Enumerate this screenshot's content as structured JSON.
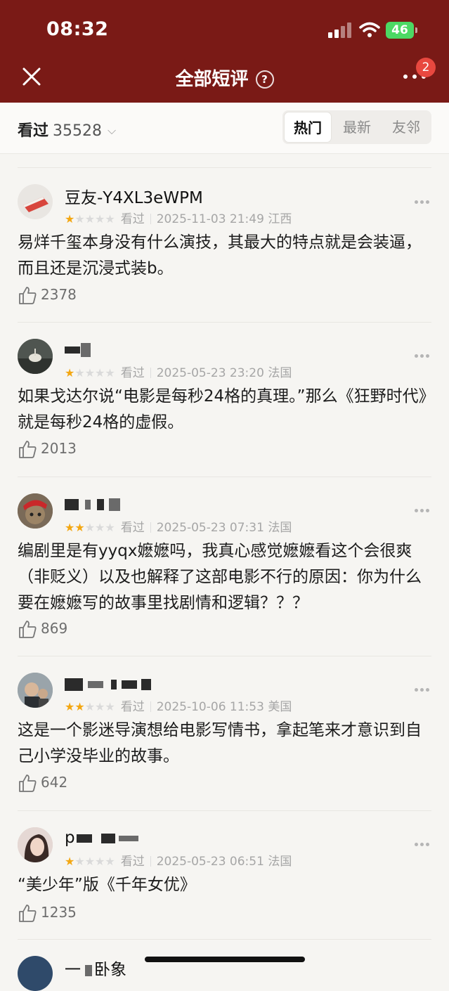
{
  "status_bar": {
    "time": "08:32",
    "battery": "46"
  },
  "nav": {
    "title": "全部短评",
    "help_glyph": "?",
    "badge_count": "2"
  },
  "filter": {
    "seen_label": "看过",
    "seen_count": "35528",
    "tabs": [
      {
        "label": "热门",
        "active": true
      },
      {
        "label": "最新",
        "active": false
      },
      {
        "label": "友邻",
        "active": false
      }
    ]
  },
  "comments": [
    {
      "username": "豆友-Y4XL3eWPM",
      "rating": 1,
      "watched_label": "看过",
      "datetime": "2025-11-03 21:49",
      "location": "江西",
      "text": "易烊千玺本身没有什么演技，其最大的特点就是会装逼，而且还是沉浸式装b。",
      "likes": "2378"
    },
    {
      "username": "",
      "rating": 1,
      "watched_label": "看过",
      "datetime": "2025-05-23 23:20",
      "location": "法国",
      "text": "如果戈达尔说“电影是每秒24格的真理。”那么《狂野时代》就是每秒24格的虚假。",
      "likes": "2013"
    },
    {
      "username": "",
      "rating": 2,
      "watched_label": "看过",
      "datetime": "2025-05-23 07:31",
      "location": "法国",
      "text": "编剧里是有yyqx嬷嬷吗，我真心感觉嬷嬷看这个会很爽（非贬义）以及也解释了这部电影不行的原因：你为什么要在嬷嬷写的故事里找剧情和逻辑？？？",
      "likes": "869"
    },
    {
      "username": "",
      "rating": 2,
      "watched_label": "看过",
      "datetime": "2025-10-06 11:53",
      "location": "美国",
      "text": "这是一个影迷导演想给电影写情书，拿起笔来才意识到自己小学没毕业的故事。",
      "likes": "642"
    },
    {
      "username": "p",
      "rating": 1,
      "watched_label": "看过",
      "datetime": "2025-05-23 06:51",
      "location": "法国",
      "text": "“美少年”版《千年女优》",
      "likes": "1235"
    },
    {
      "username": "一",
      "username_suffix": "卧象"
    }
  ],
  "colors": {
    "header_bg": "#7a1a16",
    "star": "#f3a712",
    "badge": "#e8483f",
    "battery": "#4cd964"
  }
}
